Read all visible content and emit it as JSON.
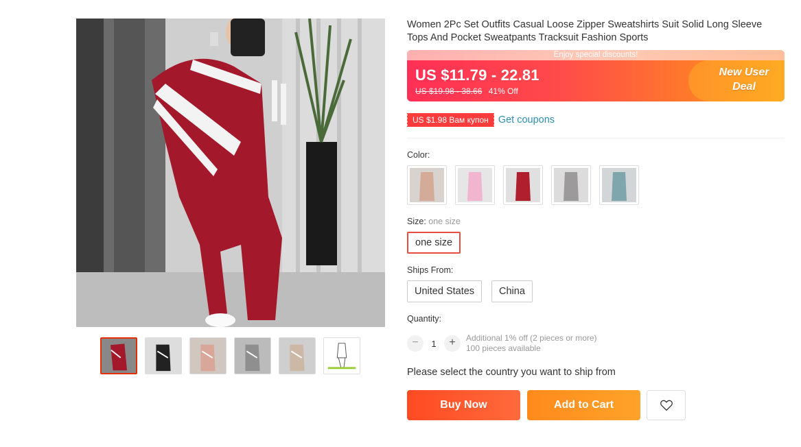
{
  "product": {
    "title": "Women 2Pc Set Outfits Casual Loose Zipper Sweatshirts Suit Solid Long Sleeve Tops And Pocket Sweatpants Tracksuit Fashion Sports",
    "main_image_icon": "product-photo",
    "thumbnail_count": 6
  },
  "price": {
    "banner": "Enjoy special discounts!",
    "current": "US $11.79 - 22.81",
    "original": "US $19.98 - 38.66",
    "discount": "41% Off",
    "deal_line1": "New User",
    "deal_line2": "Deal"
  },
  "coupon": {
    "tag": "US $1.98 Вам купон",
    "link": "Get coupons"
  },
  "color": {
    "label": "Color:",
    "options": [
      "beige",
      "pink",
      "red",
      "gray",
      "blue"
    ]
  },
  "size": {
    "label": "Size:",
    "selected": "one size",
    "option": "one size"
  },
  "ships_from": {
    "label": "Ships From:",
    "options": [
      "United States",
      "China"
    ]
  },
  "quantity": {
    "label": "Quantity:",
    "minus": "−",
    "plus": "+",
    "value": "1",
    "note1": "Additional 1% off (2 pieces or more)",
    "note2": "100 pieces available"
  },
  "ship_note": "Please select the country you want to ship from",
  "actions": {
    "buy": "Buy Now",
    "cart": "Add to Cart",
    "wish_icon": "heart-icon"
  },
  "colors": {
    "accent": "#e62e04",
    "price_gradient_start": "#ff2f56",
    "price_gradient_end": "#ffa320",
    "buy": "#ff4a22",
    "cart": "#ff8a1c",
    "link": "#2e8fb0"
  }
}
